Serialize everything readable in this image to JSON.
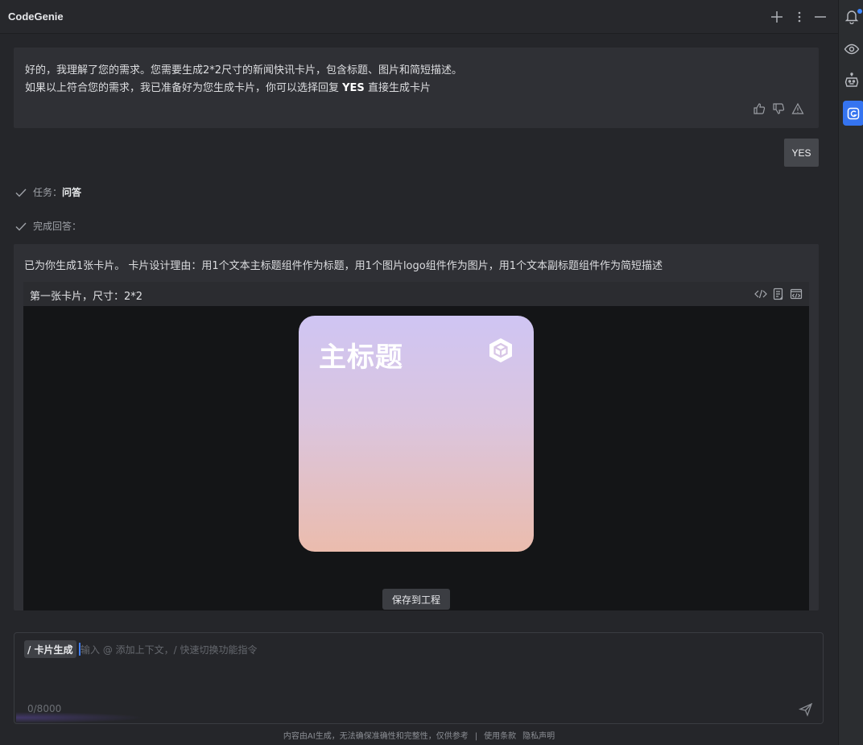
{
  "app": {
    "title": "CodeGenie"
  },
  "titlebar": {
    "icons": [
      "plus-icon",
      "more-vertical-icon",
      "minimize-icon"
    ]
  },
  "messages": {
    "ai_reply": {
      "line1": "好的，我理解了您的需求。您需要生成2*2尺寸的新闻快讯卡片，包含标题、图片和简短描述。",
      "line2_prefix": "如果以上符合您的需求，我已准备好为您生成卡片，你可以选择回复 ",
      "line2_bold": "YES",
      "line2_suffix": " 直接生成卡片",
      "feedback_icons": [
        "thumbs-up-icon",
        "thumbs-down-icon",
        "warning-icon"
      ]
    },
    "user_reply": "YES",
    "status": [
      {
        "label": "任务：",
        "value": "问答"
      },
      {
        "label": "完成回答：",
        "value": ""
      }
    ],
    "result": {
      "text": "已为你生成1张卡片。 卡片设计理由：用1个文本主标题组件作为标题，用1个图片logo组件作为图片，用1个文本副标题组件作为简短描述",
      "card_header": "第一张卡片，尺寸：2*2",
      "header_icons": [
        "code-icon",
        "copy-doc-icon",
        "preview-code-icon"
      ],
      "preview_title": "主标题",
      "save_button": "保存到工程"
    }
  },
  "input": {
    "command_tag": "/ 卡片生成",
    "placeholder": "输入 @ 添加上下文，/ 快速切换功能指令",
    "counter": "0/8000"
  },
  "footer": {
    "disclaimer": "内容由AI生成，无法确保准确性和完整性，仅供参考",
    "separator": "|",
    "terms": "使用条款",
    "privacy": "隐私声明"
  },
  "right_rail": {
    "icons": [
      "bell-icon",
      "eye-icon",
      "robot-icon",
      "codegenie-icon"
    ]
  },
  "colors": {
    "accent": "#3574f0",
    "background": "#25262a",
    "panel": "#2f3035"
  }
}
